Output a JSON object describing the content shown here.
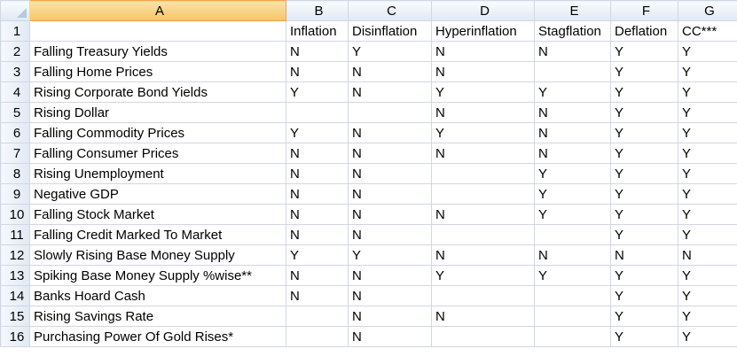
{
  "columns": [
    "A",
    "B",
    "C",
    "D",
    "E",
    "F",
    "G"
  ],
  "header_row": {
    "row_number": "1",
    "cells": [
      "",
      "Inflation",
      "Disinflation",
      "Hyperinflation",
      "Stagflation",
      "Deflation",
      "CC***"
    ]
  },
  "rows": [
    {
      "row_number": "2",
      "label": "Falling Treasury Yields",
      "values": [
        "N",
        "Y",
        "N",
        "N",
        "Y",
        "Y"
      ]
    },
    {
      "row_number": "3",
      "label": "Falling Home Prices",
      "values": [
        "N",
        "N",
        "N",
        "",
        "Y",
        "Y"
      ]
    },
    {
      "row_number": "4",
      "label": "Rising Corporate Bond Yields",
      "values": [
        "Y",
        "N",
        "Y",
        "Y",
        "Y",
        "Y"
      ]
    },
    {
      "row_number": "5",
      "label": "Rising Dollar",
      "values": [
        "",
        "",
        "N",
        "N",
        "Y",
        "Y"
      ]
    },
    {
      "row_number": "6",
      "label": "Falling Commodity Prices",
      "values": [
        "Y",
        "N",
        "Y",
        "N",
        "Y",
        "Y"
      ]
    },
    {
      "row_number": "7",
      "label": "Falling Consumer Prices",
      "values": [
        "N",
        "N",
        "N",
        "N",
        "Y",
        "Y"
      ]
    },
    {
      "row_number": "8",
      "label": "Rising Unemployment",
      "values": [
        "N",
        "N",
        "",
        "Y",
        "Y",
        "Y"
      ]
    },
    {
      "row_number": "9",
      "label": "Negative GDP",
      "values": [
        "N",
        "N",
        "",
        "Y",
        "Y",
        "Y"
      ]
    },
    {
      "row_number": "10",
      "label": "Falling Stock Market",
      "values": [
        "N",
        "N",
        "N",
        "Y",
        "Y",
        "Y"
      ]
    },
    {
      "row_number": "11",
      "label": "Falling Credit Marked To Market",
      "values": [
        "N",
        "N",
        "",
        "",
        "Y",
        "Y"
      ]
    },
    {
      "row_number": "12",
      "label": "Slowly Rising Base Money Supply",
      "values": [
        "Y",
        "Y",
        "N",
        "N",
        "N",
        "N"
      ]
    },
    {
      "row_number": "13",
      "label": "Spiking Base Money Supply %wise**",
      "values": [
        "N",
        "N",
        "Y",
        "Y",
        "Y",
        "Y"
      ]
    },
    {
      "row_number": "14",
      "label": "Banks Hoard Cash",
      "values": [
        "N",
        "N",
        "",
        "",
        "Y",
        "Y"
      ]
    },
    {
      "row_number": "15",
      "label": "Rising Savings Rate",
      "values": [
        "",
        "N",
        "N",
        "",
        "Y",
        "Y"
      ]
    },
    {
      "row_number": "16",
      "label": "Purchasing Power Of Gold Rises*",
      "values": [
        "",
        "N",
        "",
        "",
        "Y",
        "Y"
      ]
    }
  ],
  "colors": {
    "grid": "#d0d7e5",
    "header_border": "#9eb6ce",
    "active_header": "#f5c565"
  }
}
